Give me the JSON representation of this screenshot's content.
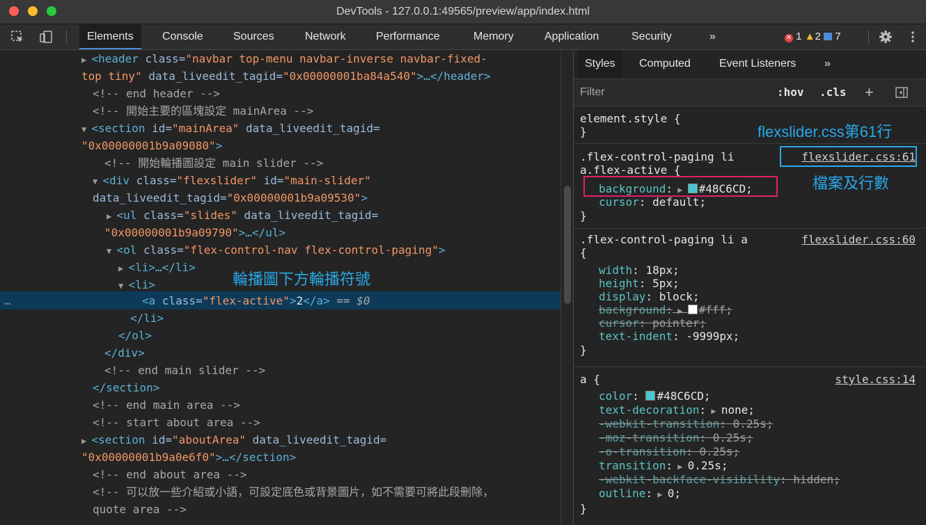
{
  "window": {
    "title": "DevTools - 127.0.0.1:49565/preview/app/index.html"
  },
  "toolbar": {
    "tabs": [
      "Elements",
      "Console",
      "Sources",
      "Network",
      "Performance",
      "Memory",
      "Application",
      "Security"
    ],
    "more": "»",
    "errors": "1",
    "warnings": "2",
    "messages": "7",
    "colors": {
      "error": "#e0443e",
      "warning": "#f2c037",
      "message": "#4a8cd6"
    }
  },
  "dom_lines": [
    [
      "▶ ",
      "<header ",
      "class=",
      "\"navbar top-menu navbar-inverse navbar-fixed-"
    ],
    [
      "",
      "",
      "",
      "top tiny\" data_liveedit_tagid=\"0x00000001ba84a540\">…</header>"
    ],
    [
      "",
      "<!-- end header -->"
    ],
    [
      "",
      "<!-- 開始主要的區塊設定 mainArea -->"
    ],
    [
      "▼ ",
      "<section ",
      "id=",
      "\"mainArea\" data_liveedit_tagid="
    ],
    [
      "",
      "\"0x00000001b9a09080\">"
    ],
    [
      "",
      "<!-- 開始輪播圖設定 main slider -->"
    ],
    [
      "▼ ",
      "<div ",
      "class=",
      "\"flexslider\" id=\"main-slider\""
    ],
    [
      "",
      "data_liveedit_tagid=\"0x00000001b9a09530\">"
    ],
    [
      "▶ ",
      "<ul ",
      "class=",
      "\"slides\" data_liveedit_tagid="
    ],
    [
      "",
      "\"0x00000001b9a09790\">…</ul>"
    ],
    [
      "▼ ",
      "<ol ",
      "class=",
      "\"flex-control-nav flex-control-paging\">"
    ],
    [
      "▶ ",
      "<li>…</li>"
    ],
    [
      "▼ ",
      "<li>"
    ],
    [
      "",
      "<a class=\"flex-active\">2</a> == $0"
    ],
    [
      "",
      "</li>"
    ],
    [
      "",
      "</ol>"
    ],
    [
      "",
      "</div>"
    ],
    [
      "",
      "<!-- end main slider -->"
    ],
    [
      "",
      "</section>"
    ],
    [
      "",
      "<!-- end main area -->"
    ],
    [
      "",
      "<!-- start about area -->"
    ],
    [
      "▶ ",
      "<section ",
      "id=",
      "\"aboutArea\" data_liveedit_tagid="
    ],
    [
      "",
      "\"0x00000001b9a0e6f0\">…</section>"
    ],
    [
      "",
      "<!-- end about area -->"
    ],
    [
      "",
      "<!-- 可以放一些介紹或小語，可設定底色或背景圖片，如不需要可將此段刪除，"
    ],
    [
      "",
      "quote area -->"
    ]
  ],
  "dom": {
    "header_open": "<header",
    "header_attr1": " class=",
    "header_val1": "\"navbar top-menu navbar-inverse navbar-fixed-",
    "header_val2": "top tiny\"",
    "header_attr2": " data_liveedit_tagid=",
    "header_val3": "\"0x00000001ba84a540\"",
    "header_close": ">…</header>",
    "c_end_header": "<!-- end header -->",
    "c_main_start": "<!-- 開始主要的區塊設定 mainArea -->",
    "section_open": "<section",
    "section_attr1": " id=",
    "section_val1": "\"mainArea\"",
    "section_attr2": " data_liveedit_tagid=",
    "section_val2": "\"0x00000001b9a09080\"",
    "gt": ">",
    "c_slider_start": "<!-- 開始輪播圖設定 main slider -->",
    "div_open": "<div",
    "div_attr1": " class=",
    "div_val1": "\"flexslider\"",
    "div_attr2": " id=",
    "div_val2": "\"main-slider\"",
    "div_attr3": "data_liveedit_tagid=",
    "div_val3": "\"0x00000001b9a09530\"",
    "ul_open": "<ul",
    "ul_attr1": " class=",
    "ul_val1": "\"slides\"",
    "ul_attr2": " data_liveedit_tagid=",
    "ul_val2": "\"0x00000001b9a09790\"",
    "ul_close": ">…</ul>",
    "ol_open": "<ol",
    "ol_attr1": " class=",
    "ol_val1": "\"flex-control-nav flex-control-paging\"",
    "li_collapsed": "<li>…</li>",
    "li_open": "<li>",
    "a_open": "<a",
    "a_attr": " class=",
    "a_val": "\"flex-active\"",
    "a_text": "2",
    "a_close": "</a>",
    "a_eq": " == ",
    "a_dollar": "$0",
    "li_close": "</li>",
    "ol_close": "</ol>",
    "div_close": "</div>",
    "c_end_slider": "<!-- end main slider -->",
    "section_close": "</section>",
    "c_end_main": "<!-- end main area -->",
    "c_start_about": "<!-- start about area -->",
    "about_open": "<section",
    "about_attr1": " id=",
    "about_val1": "\"aboutArea\"",
    "about_attr2": " data_liveedit_tagid=",
    "about_val2": "\"0x00000001b9a0e6f0\"",
    "about_close": ">…</section>",
    "c_end_about": "<!-- end about area -->",
    "c_quote1": "<!-- 可以放一些介紹或小語，可設定底色或背景圖片，如不需要可將此段刪除，",
    "c_quote2": "quote area -->",
    "ellipsis": "…"
  },
  "styles_panel": {
    "tabs": [
      "Styles",
      "Computed",
      "Event Listeners",
      "»"
    ],
    "filter_placeholder": "Filter",
    "hov": ":hov",
    "cls": ".cls",
    "plus": "+",
    "rule0_selector": "element.style {",
    "close_brace": "}",
    "rule1_sel1": ".flex-control-paging li",
    "rule1_sel2": "a.flex-active {",
    "rule1_src": "flexslider.css:61",
    "rule1_props": [
      {
        "name": "background",
        "value": "#48C6CD",
        "swatch": "#48C6CD"
      },
      {
        "name": "cursor",
        "value": "default"
      }
    ],
    "rule2_sel1": ".flex-control-paging li a",
    "rule2_sel2": "{",
    "rule2_src": "flexslider.css:60",
    "rule2_props": [
      {
        "name": "width",
        "value": "18px"
      },
      {
        "name": "height",
        "value": "5px"
      },
      {
        "name": "display",
        "value": "block"
      },
      {
        "name": "background",
        "value": "#fff",
        "swatch": "#ffffff",
        "strike": true
      },
      {
        "name": "cursor",
        "value": "pointer",
        "strike": true
      },
      {
        "name": "text-indent",
        "value": "-9999px"
      }
    ],
    "rule3_sel": "a {",
    "rule3_src": "style.css:14",
    "rule3_props": [
      {
        "name": "color",
        "value": "#48C6CD",
        "swatch": "#48C6CD"
      },
      {
        "name": "text-decoration",
        "value": "none",
        "arrow": true
      },
      {
        "name": "-webkit-transition",
        "value": "0.25s",
        "strike": true
      },
      {
        "name": "-moz-transition",
        "value": "0.25s",
        "strike": true
      },
      {
        "name": "-o-transition",
        "value": "0.25s",
        "strike": true
      },
      {
        "name": "transition",
        "value": "0.25s",
        "arrow": true
      },
      {
        "name": "-webkit-backface-visibility",
        "value": "hidden",
        "strike": true
      },
      {
        "name": "outline",
        "value": "0",
        "arrow": true
      }
    ]
  },
  "annotations": {
    "carousel_note": "輪播圖下方輪播符號",
    "file_line_note": "flexslider.css第61行",
    "file_line_caption": "檔案及行數",
    "color_cyan": "#27a8e8",
    "color_pink": "#e0206a"
  }
}
